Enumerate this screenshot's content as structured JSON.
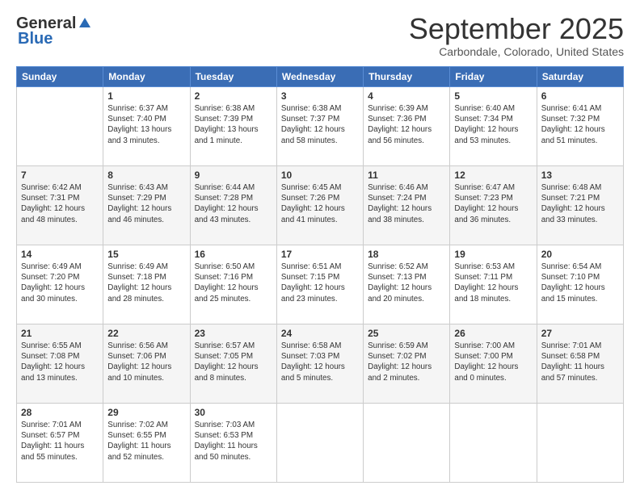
{
  "header": {
    "logo_general": "General",
    "logo_blue": "Blue",
    "month": "September 2025",
    "location": "Carbondale, Colorado, United States"
  },
  "weekdays": [
    "Sunday",
    "Monday",
    "Tuesday",
    "Wednesday",
    "Thursday",
    "Friday",
    "Saturday"
  ],
  "weeks": [
    [
      {
        "day": "",
        "info": ""
      },
      {
        "day": "1",
        "info": "Sunrise: 6:37 AM\nSunset: 7:40 PM\nDaylight: 13 hours\nand 3 minutes."
      },
      {
        "day": "2",
        "info": "Sunrise: 6:38 AM\nSunset: 7:39 PM\nDaylight: 13 hours\nand 1 minute."
      },
      {
        "day": "3",
        "info": "Sunrise: 6:38 AM\nSunset: 7:37 PM\nDaylight: 12 hours\nand 58 minutes."
      },
      {
        "day": "4",
        "info": "Sunrise: 6:39 AM\nSunset: 7:36 PM\nDaylight: 12 hours\nand 56 minutes."
      },
      {
        "day": "5",
        "info": "Sunrise: 6:40 AM\nSunset: 7:34 PM\nDaylight: 12 hours\nand 53 minutes."
      },
      {
        "day": "6",
        "info": "Sunrise: 6:41 AM\nSunset: 7:32 PM\nDaylight: 12 hours\nand 51 minutes."
      }
    ],
    [
      {
        "day": "7",
        "info": "Sunrise: 6:42 AM\nSunset: 7:31 PM\nDaylight: 12 hours\nand 48 minutes."
      },
      {
        "day": "8",
        "info": "Sunrise: 6:43 AM\nSunset: 7:29 PM\nDaylight: 12 hours\nand 46 minutes."
      },
      {
        "day": "9",
        "info": "Sunrise: 6:44 AM\nSunset: 7:28 PM\nDaylight: 12 hours\nand 43 minutes."
      },
      {
        "day": "10",
        "info": "Sunrise: 6:45 AM\nSunset: 7:26 PM\nDaylight: 12 hours\nand 41 minutes."
      },
      {
        "day": "11",
        "info": "Sunrise: 6:46 AM\nSunset: 7:24 PM\nDaylight: 12 hours\nand 38 minutes."
      },
      {
        "day": "12",
        "info": "Sunrise: 6:47 AM\nSunset: 7:23 PM\nDaylight: 12 hours\nand 36 minutes."
      },
      {
        "day": "13",
        "info": "Sunrise: 6:48 AM\nSunset: 7:21 PM\nDaylight: 12 hours\nand 33 minutes."
      }
    ],
    [
      {
        "day": "14",
        "info": "Sunrise: 6:49 AM\nSunset: 7:20 PM\nDaylight: 12 hours\nand 30 minutes."
      },
      {
        "day": "15",
        "info": "Sunrise: 6:49 AM\nSunset: 7:18 PM\nDaylight: 12 hours\nand 28 minutes."
      },
      {
        "day": "16",
        "info": "Sunrise: 6:50 AM\nSunset: 7:16 PM\nDaylight: 12 hours\nand 25 minutes."
      },
      {
        "day": "17",
        "info": "Sunrise: 6:51 AM\nSunset: 7:15 PM\nDaylight: 12 hours\nand 23 minutes."
      },
      {
        "day": "18",
        "info": "Sunrise: 6:52 AM\nSunset: 7:13 PM\nDaylight: 12 hours\nand 20 minutes."
      },
      {
        "day": "19",
        "info": "Sunrise: 6:53 AM\nSunset: 7:11 PM\nDaylight: 12 hours\nand 18 minutes."
      },
      {
        "day": "20",
        "info": "Sunrise: 6:54 AM\nSunset: 7:10 PM\nDaylight: 12 hours\nand 15 minutes."
      }
    ],
    [
      {
        "day": "21",
        "info": "Sunrise: 6:55 AM\nSunset: 7:08 PM\nDaylight: 12 hours\nand 13 minutes."
      },
      {
        "day": "22",
        "info": "Sunrise: 6:56 AM\nSunset: 7:06 PM\nDaylight: 12 hours\nand 10 minutes."
      },
      {
        "day": "23",
        "info": "Sunrise: 6:57 AM\nSunset: 7:05 PM\nDaylight: 12 hours\nand 8 minutes."
      },
      {
        "day": "24",
        "info": "Sunrise: 6:58 AM\nSunset: 7:03 PM\nDaylight: 12 hours\nand 5 minutes."
      },
      {
        "day": "25",
        "info": "Sunrise: 6:59 AM\nSunset: 7:02 PM\nDaylight: 12 hours\nand 2 minutes."
      },
      {
        "day": "26",
        "info": "Sunrise: 7:00 AM\nSunset: 7:00 PM\nDaylight: 12 hours\nand 0 minutes."
      },
      {
        "day": "27",
        "info": "Sunrise: 7:01 AM\nSunset: 6:58 PM\nDaylight: 11 hours\nand 57 minutes."
      }
    ],
    [
      {
        "day": "28",
        "info": "Sunrise: 7:01 AM\nSunset: 6:57 PM\nDaylight: 11 hours\nand 55 minutes."
      },
      {
        "day": "29",
        "info": "Sunrise: 7:02 AM\nSunset: 6:55 PM\nDaylight: 11 hours\nand 52 minutes."
      },
      {
        "day": "30",
        "info": "Sunrise: 7:03 AM\nSunset: 6:53 PM\nDaylight: 11 hours\nand 50 minutes."
      },
      {
        "day": "",
        "info": ""
      },
      {
        "day": "",
        "info": ""
      },
      {
        "day": "",
        "info": ""
      },
      {
        "day": "",
        "info": ""
      }
    ]
  ]
}
